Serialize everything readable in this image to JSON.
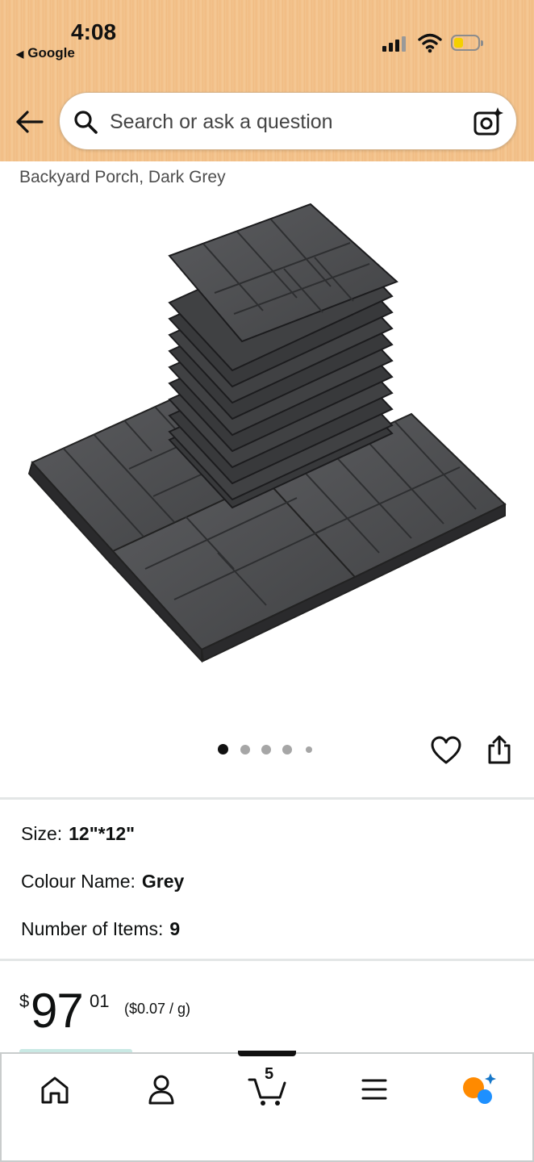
{
  "status_bar": {
    "time": "4:08",
    "back_app": "Google",
    "icons": [
      "cellular-signal-icon",
      "wifi-icon",
      "battery-icon"
    ]
  },
  "search": {
    "placeholder": "Search or ask a question",
    "icons": [
      "back-arrow-icon",
      "search-icon",
      "camera-lens-icon"
    ]
  },
  "product": {
    "title_visible": "Backyard Porch, Dark Grey",
    "image_description": "stack of dark grey interlocking deck tiles",
    "carousel": {
      "total": 5,
      "current": 1
    },
    "actions": [
      "heart-icon",
      "share-icon"
    ]
  },
  "attributes": {
    "size": {
      "label": "Size:",
      "value": "12\"*12\""
    },
    "colour": {
      "label": "Colour Name:",
      "value": "Grey"
    },
    "items": {
      "label": "Number of Items:",
      "value": "9"
    }
  },
  "price": {
    "symbol": "$",
    "whole": "97",
    "fraction": "01",
    "unit_price": "($0.07 / g)"
  },
  "bottom_nav": {
    "items": [
      "home-icon",
      "account-icon",
      "cart-icon",
      "menu-icon",
      "ai-assistant-icon"
    ],
    "cart_count": "5",
    "active": "cart"
  },
  "colors": {
    "header_bg": "#f3c48f",
    "tile": "#4a4b4d",
    "text": "#0f1111",
    "battery_fill": "#f4d000",
    "assistant_orange": "#ff8a00",
    "assistant_blue": "#1e90ff"
  }
}
